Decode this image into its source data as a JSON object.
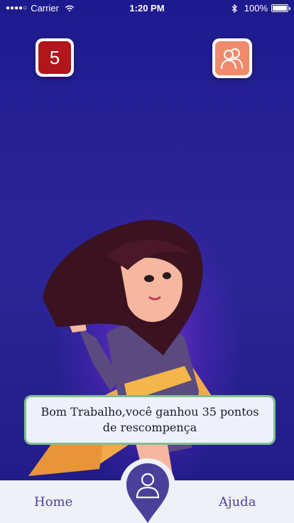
{
  "status_bar": {
    "carrier": "Carrier",
    "time": "1:20 PM",
    "battery": "100%"
  },
  "level": {
    "value": "5"
  },
  "message": {
    "text": "Bom Trabalho,você ganhou 35 pontos de rescompença"
  },
  "nav": {
    "home_label": "Home",
    "help_label": "Ajuda"
  },
  "icons": {
    "users": "users-icon",
    "profile": "profile-pin-icon",
    "wifi": "wifi-icon",
    "bluetooth": "bluetooth-icon",
    "battery": "battery-icon"
  },
  "colors": {
    "background": "#1d1a8e",
    "level_badge": "#b0161b",
    "users_button": "#f08a6c",
    "nav_text": "#4a3f99",
    "pin": "#4a3f99",
    "message_border": "#7fbf8f"
  }
}
